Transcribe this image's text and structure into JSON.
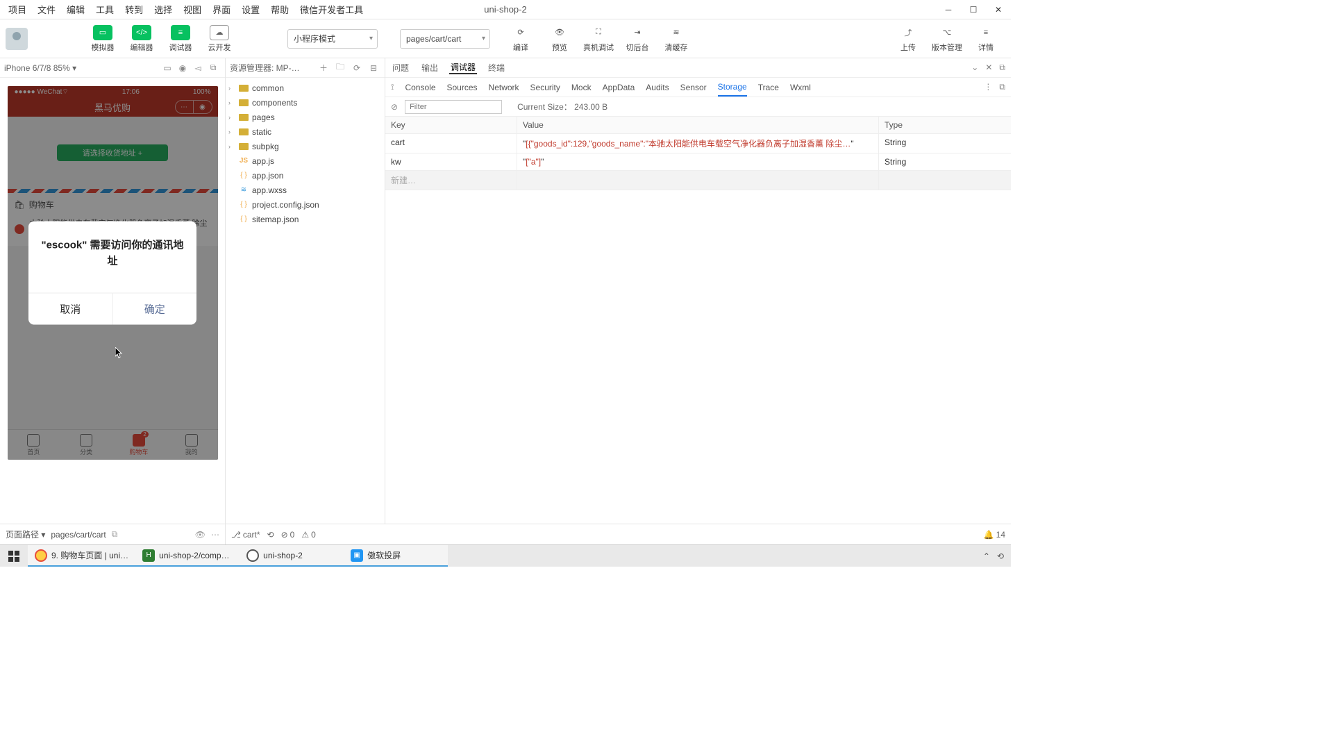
{
  "window": {
    "title": "uni-shop-2"
  },
  "menubar": [
    "项目",
    "文件",
    "编辑",
    "工具",
    "转到",
    "选择",
    "视图",
    "界面",
    "设置",
    "帮助",
    "微信开发者工具"
  ],
  "toolbar": {
    "simulator": "模拟器",
    "editor": "编辑器",
    "debugger": "调试器",
    "cloud": "云开发",
    "compile_mode": "小程序模式",
    "page_path": "pages/cart/cart",
    "compile": "编译",
    "preview": "预览",
    "remote": "真机调试",
    "background": "切后台",
    "clear_cache": "清缓存",
    "upload": "上传",
    "version": "版本管理",
    "details": "详情"
  },
  "simulator": {
    "device": "iPhone 6/7/8 85%",
    "status_left": "●●●●● WeChat",
    "status_wifi": "⌔",
    "status_time": "17:06",
    "status_right": "100%",
    "nav_title": "黑马优购",
    "addr_btn": "请选择收货地址 +",
    "cart_label": "购物车",
    "goods_text": "本驰太阳能供电车载空气净化器负离子加湿香薰 除尘去异味清洁空气黑色",
    "modal_message": "\"escook\" 需要访问你的通讯地址",
    "modal_cancel": "取消",
    "modal_ok": "确定",
    "tabs": [
      {
        "label": "首页"
      },
      {
        "label": "分类"
      },
      {
        "label": "购物车",
        "badge": "2"
      },
      {
        "label": "我的"
      }
    ],
    "footer_label": "页面路径",
    "footer_path": "pages/cart/cart"
  },
  "explorer": {
    "title": "资源管理器: MP-…",
    "tree": [
      {
        "type": "folder",
        "name": "common",
        "expandable": true
      },
      {
        "type": "folder",
        "name": "components",
        "expandable": true
      },
      {
        "type": "folder",
        "name": "pages",
        "expandable": true
      },
      {
        "type": "folder",
        "name": "static",
        "expandable": true
      },
      {
        "type": "folder",
        "name": "subpkg",
        "expandable": true
      },
      {
        "type": "js",
        "name": "app.js"
      },
      {
        "type": "json",
        "name": "app.json"
      },
      {
        "type": "wxss",
        "name": "app.wxss"
      },
      {
        "type": "json",
        "name": "project.config.json"
      },
      {
        "type": "json",
        "name": "sitemap.json"
      }
    ]
  },
  "debug": {
    "outer_tabs": [
      "问题",
      "输出",
      "调试器",
      "终端"
    ],
    "outer_active": "调试器",
    "devtools_tabs": [
      "Console",
      "Sources",
      "Network",
      "Security",
      "Mock",
      "AppData",
      "Audits",
      "Sensor",
      "Storage",
      "Trace",
      "Wxml"
    ],
    "devtools_active": "Storage",
    "filter_placeholder": "Filter",
    "size_label": "Current Size：",
    "size_value": "243.00 B",
    "columns": {
      "key": "Key",
      "value": "Value",
      "type": "Type"
    },
    "rows": [
      {
        "key": "cart",
        "value": "[{\"goods_id\":129,\"goods_name\":\"本驰太阳能供电车载空气净化器负离子加湿香薰 除尘…",
        "type": "String"
      },
      {
        "key": "kw",
        "value": "[\"a\"]",
        "type": "String"
      }
    ],
    "new_row_placeholder": "新建…"
  },
  "editor_footer": {
    "branch_icon": "⎇",
    "branch": "cart*",
    "sync": "⟲",
    "errors": "0",
    "warnings": "0",
    "notif_count": "14"
  },
  "taskbar": {
    "tasks": [
      {
        "label": "9. 购物车页面 | uni…",
        "color": "#ffce44",
        "ring": "#e74c3c"
      },
      {
        "label": "uni-shop-2/comp…",
        "color": "#2e7d32",
        "text": "H"
      },
      {
        "label": "uni-shop-2",
        "color": "#fff",
        "ring": "#555"
      },
      {
        "label": "傲软投屏",
        "color": "#2196f3",
        "text": "▣"
      }
    ]
  }
}
